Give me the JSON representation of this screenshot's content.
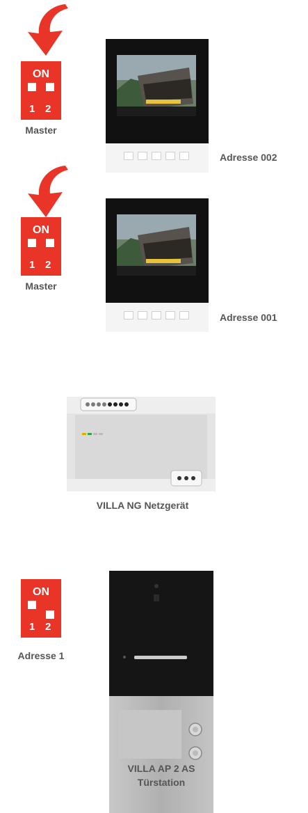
{
  "switch_on_label": "ON",
  "switch_numbers": [
    "1",
    "2"
  ],
  "switches": [
    {
      "label": "Master"
    },
    {
      "label": "Master"
    },
    {
      "label": "Adresse 1"
    }
  ],
  "monitors": [
    {
      "address": "Adresse 002"
    },
    {
      "address": "Adresse 001"
    }
  ],
  "power_supply": {
    "label": "VILLA NG Netzgerät"
  },
  "door_station": {
    "label_line1": "VILLA AP 2 AS",
    "label_line2": "Türstation"
  },
  "colors": {
    "arrow": "#e83528",
    "switch": "#e83528",
    "label": "#555555"
  }
}
